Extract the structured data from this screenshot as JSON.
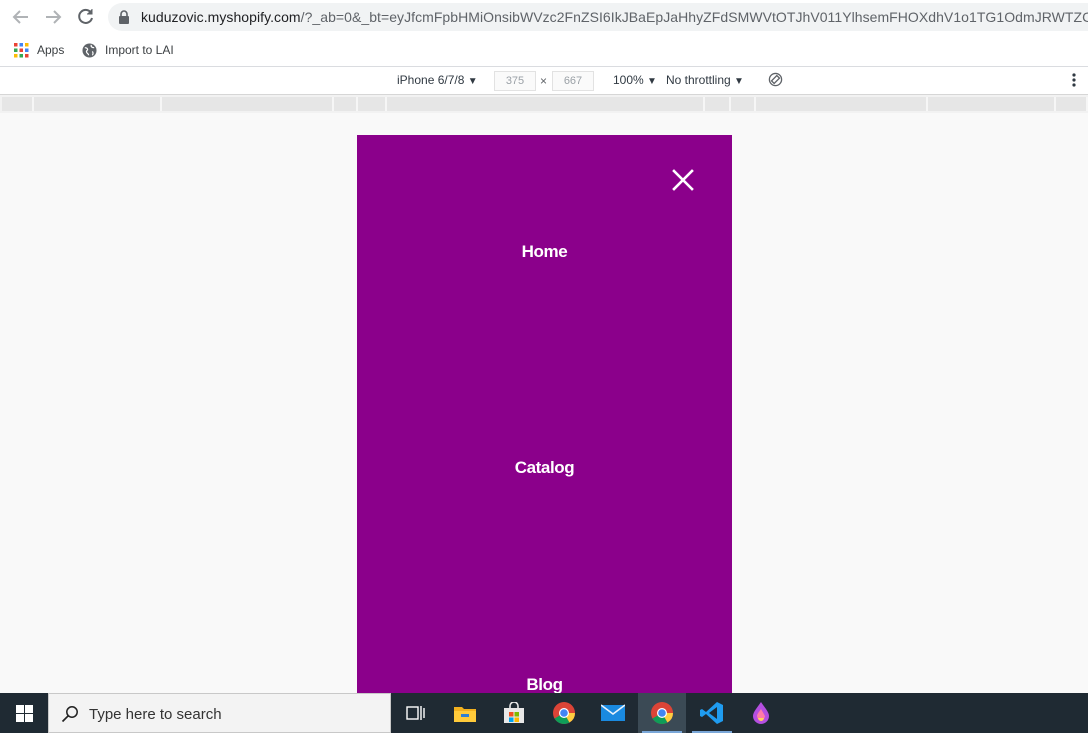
{
  "browser": {
    "url_host": "kuduzovic.myshopify.com",
    "url_rest": "/?_ab=0&_bt=eyJfcmFpbHMiOnsibWVzc2FnZSI6IkJBaEpJaHhyZFdSMWVtOTJhV011YlhsemFHOXdhV1o1TG1OdmJRWTZCa1ZV..."
  },
  "bookmarks": [
    {
      "label": "Apps",
      "icon": "apps-grid-icon"
    },
    {
      "label": "Import to LAI",
      "icon": "globe-icon"
    }
  ],
  "device_toolbar": {
    "device": "iPhone 6/7/8",
    "width": "375",
    "times": "×",
    "height": "667",
    "zoom": "100%",
    "throttling": "No throttling",
    "dropdown_arrow": "▼"
  },
  "mobile_menu": {
    "background": "#8b008b",
    "links": [
      "Home",
      "Catalog",
      "Blog"
    ]
  },
  "taskbar": {
    "search_placeholder": "Type here to search"
  }
}
